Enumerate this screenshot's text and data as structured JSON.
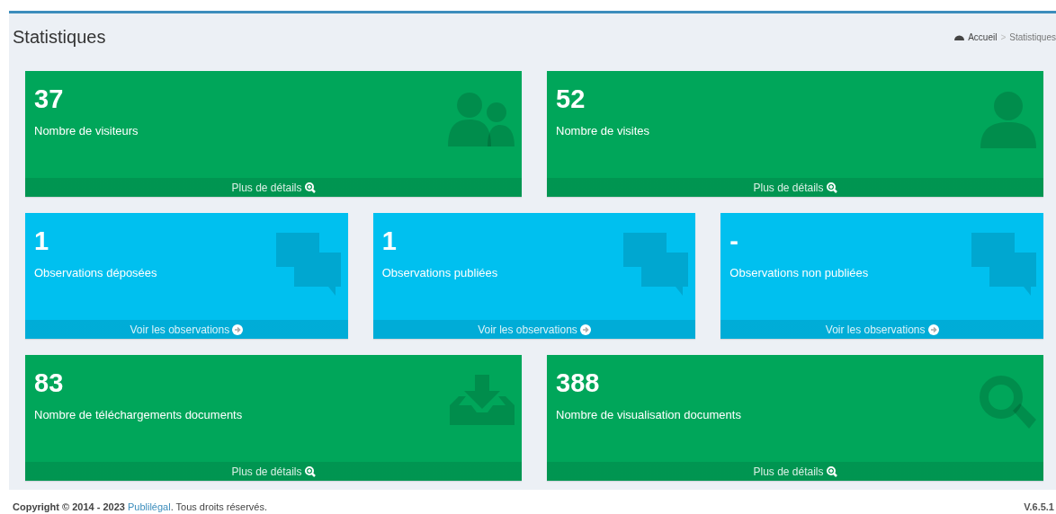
{
  "header": {
    "title": "Statistiques",
    "breadcrumb": [
      "Accueil",
      "Statistiques"
    ],
    "breadcrumb_separator": ">"
  },
  "rows": [
    {
      "boxes": [
        {
          "number": "37",
          "label": "Nombre de visiteurs",
          "link": "Plus de détails",
          "color": "#00a65a"
        },
        {
          "number": "52",
          "label": "Nombre de visites",
          "link": "Plus de détails",
          "color": "#00a65a"
        }
      ]
    },
    {
      "boxes": [
        {
          "number": "1",
          "label": "Observations déposées",
          "link": "Voir les observations",
          "color": "#00c0ef"
        },
        {
          "number": "1",
          "label": "Observations publiées",
          "link": "Voir les observations",
          "color": "#00c0ef"
        },
        {
          "number": "-",
          "label": "Observations non publiées",
          "link": "Voir les observations",
          "color": "#00c0ef"
        }
      ]
    },
    {
      "boxes": [
        {
          "number": "83",
          "label": "Nombre de téléchargements documents",
          "link": "Plus de détails",
          "color": "#00a65a"
        },
        {
          "number": "388",
          "label": "Nombre de visualisation documents",
          "link": "Plus de détails",
          "color": "#00a65a"
        }
      ]
    }
  ],
  "footer": {
    "copyright_before": "Copyright © 2014 - 2023",
    "company_link": "Publilégal",
    "copyright_after": ". Tous droits réservés.",
    "version": "V.6.5.1"
  }
}
